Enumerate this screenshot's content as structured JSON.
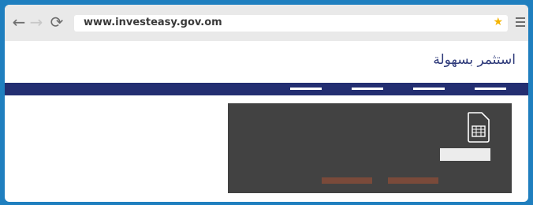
{
  "browser": {
    "url": "www.investeasy.gov.om",
    "icons": [
      "back-arrow-icon",
      "forward-arrow-icon",
      "reload-icon",
      "star-icon",
      "menu-icon"
    ]
  },
  "site": {
    "title": "استثمر بسهولة",
    "nav_item_count": 4
  },
  "panel": {
    "icon": "sim-card-icon",
    "colors": {
      "panel": "#424242",
      "navbar": "#232e71",
      "buttons": "#7a4a3a",
      "frame": "#1f7fbf"
    }
  }
}
